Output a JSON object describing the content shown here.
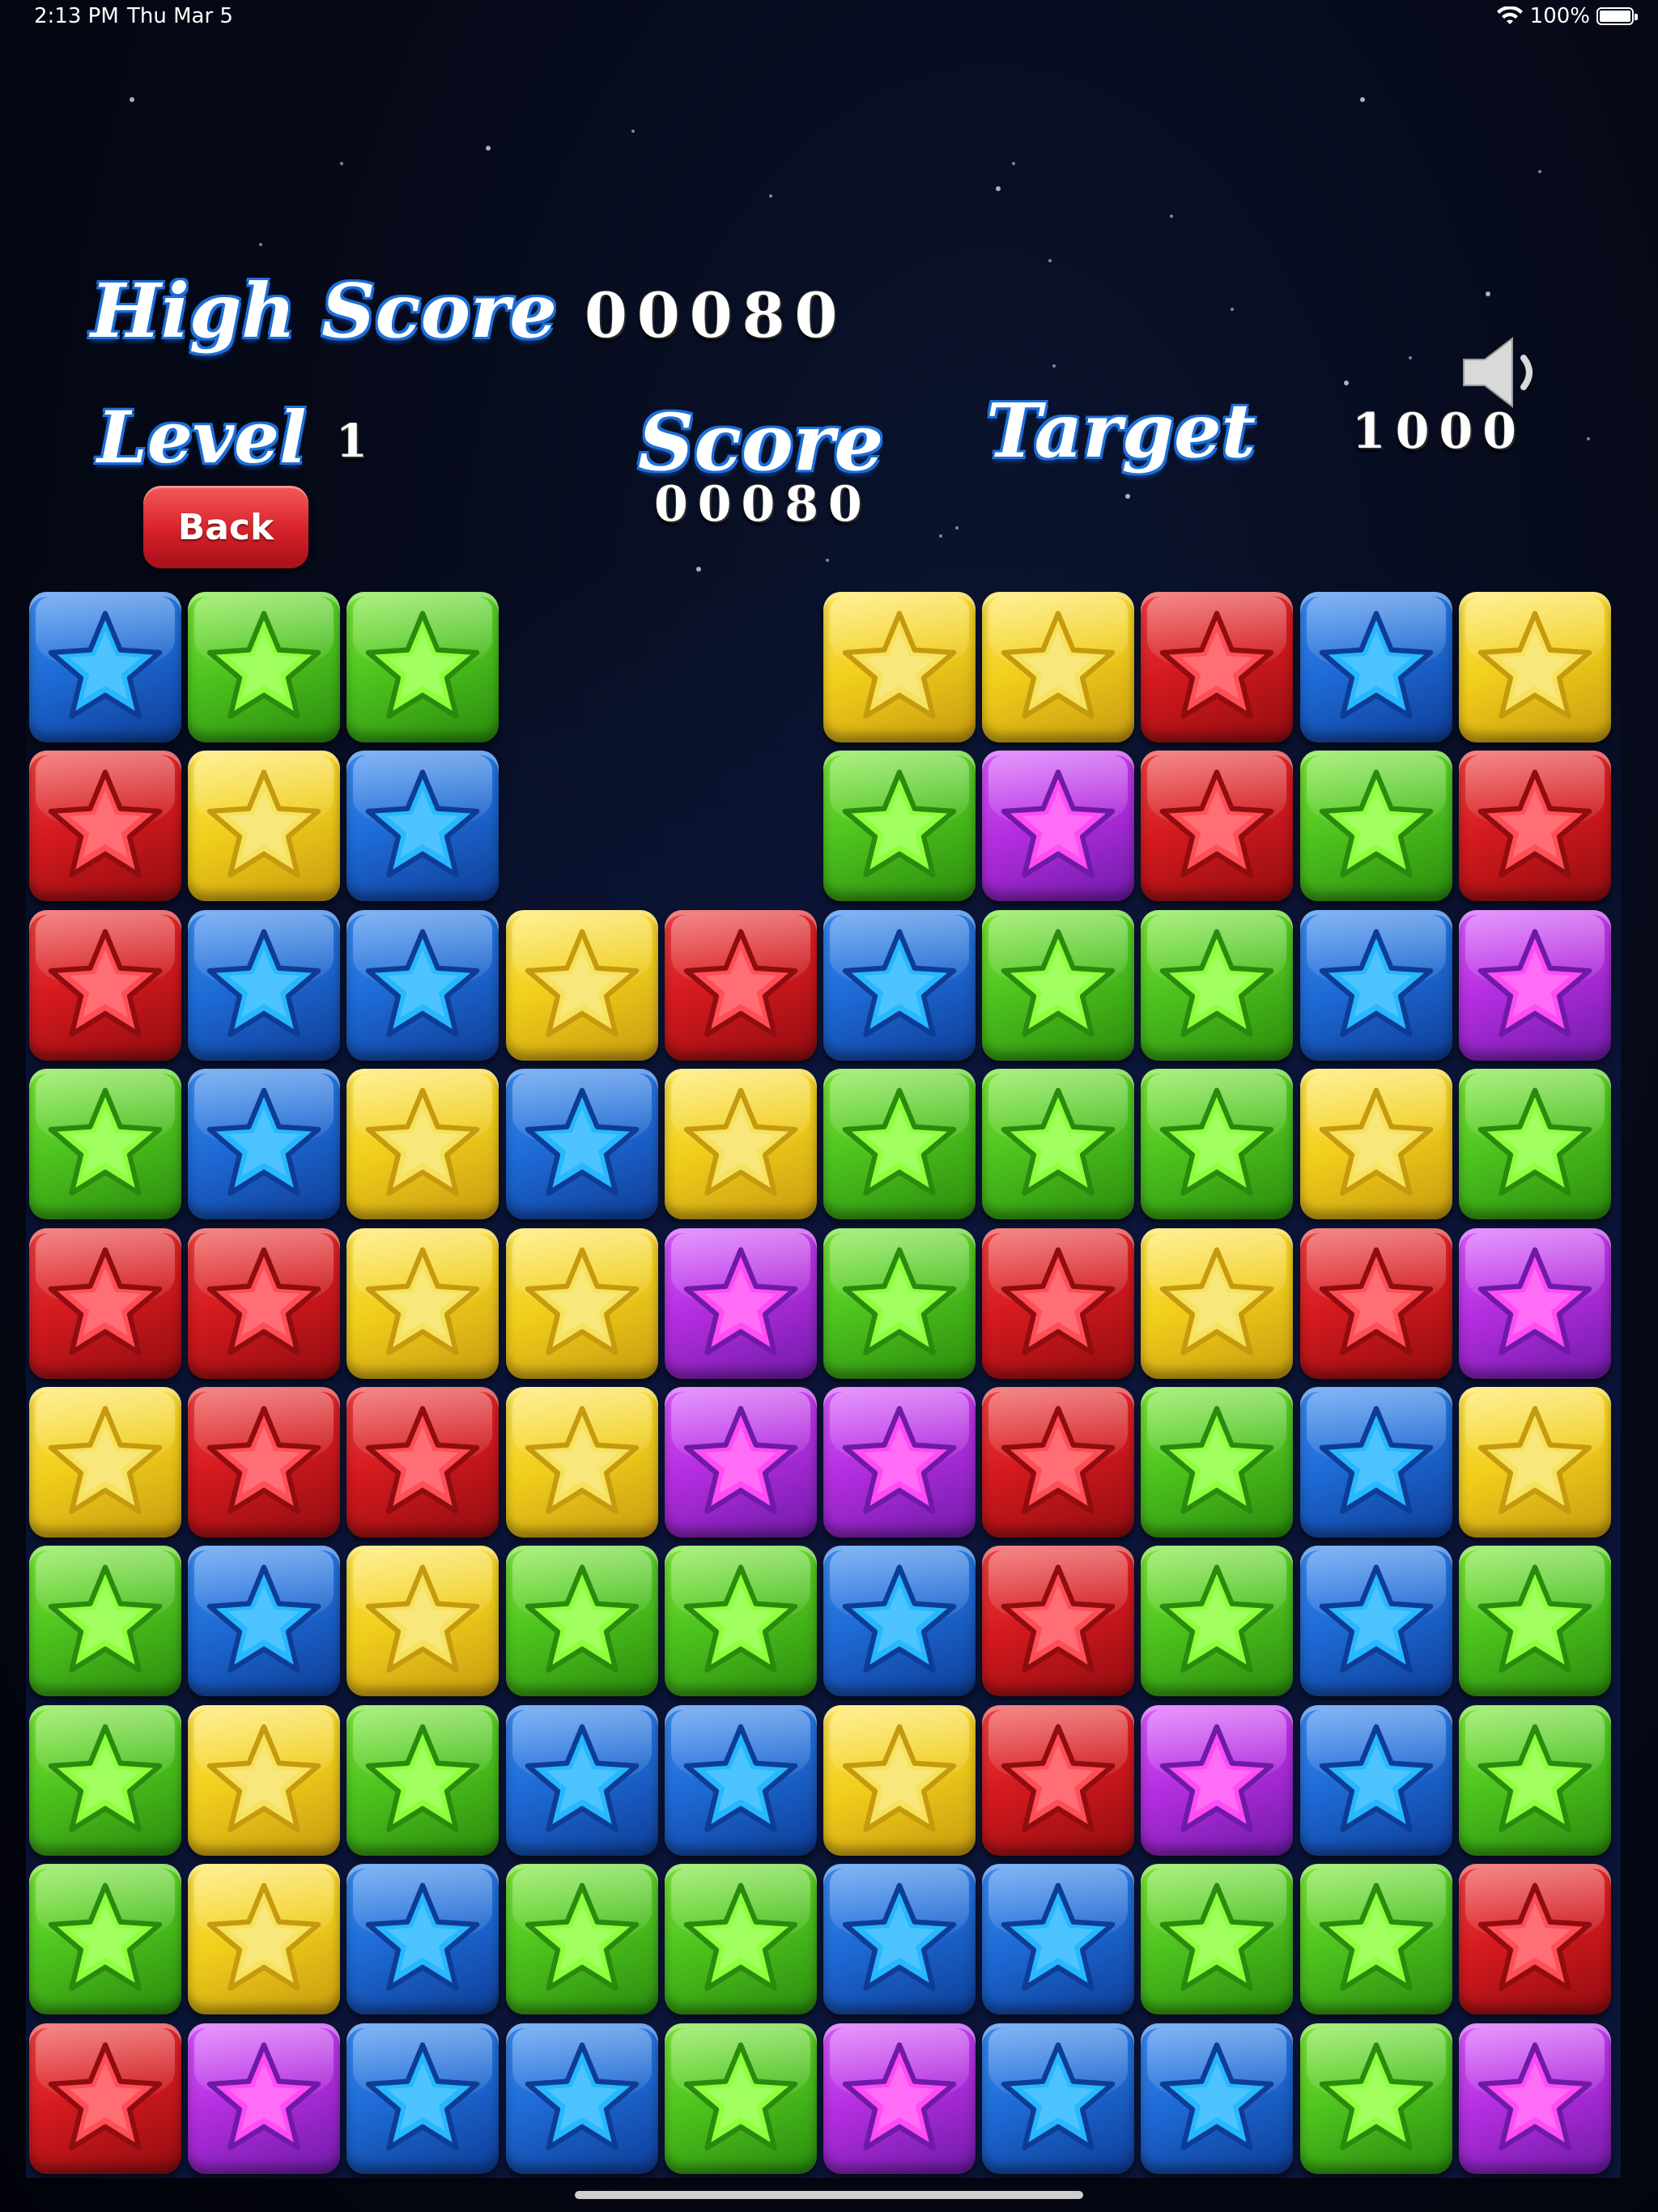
{
  "status_bar": {
    "time": "2:13 PM",
    "date": "Thu Mar 5",
    "battery": "100%",
    "wifi_icon": "wifi-icon",
    "battery_icon": "battery-icon"
  },
  "hud": {
    "high_score_label": "High Score",
    "high_score_value": "00080",
    "level_label": "Level",
    "level_value": "1",
    "score_label": "Score",
    "score_value": "00080",
    "target_label": "Target",
    "target_value": "1000",
    "back_label": "Back",
    "sound_icon": "speaker-icon"
  },
  "colors": {
    "blue": "#1e6bd6",
    "green": "#4ec41f",
    "yellow": "#f2cf1c",
    "red": "#d51a1e",
    "purple": "#b52ee0"
  },
  "board": {
    "rows": 10,
    "cols": 10,
    "grid": [
      [
        "B",
        "G",
        "G",
        "",
        "",
        "Y",
        "Y",
        "R",
        "B",
        "Y"
      ],
      [
        "R",
        "Y",
        "B",
        "",
        "",
        "G",
        "P",
        "R",
        "G",
        "R"
      ],
      [
        "R",
        "B",
        "B",
        "Y",
        "R",
        "B",
        "G",
        "G",
        "B",
        "P"
      ],
      [
        "G",
        "B",
        "Y",
        "B",
        "Y",
        "G",
        "G",
        "G",
        "Y",
        "G"
      ],
      [
        "R",
        "R",
        "Y",
        "Y",
        "P",
        "G",
        "R",
        "Y",
        "R",
        "P"
      ],
      [
        "Y",
        "R",
        "R",
        "Y",
        "P",
        "P",
        "R",
        "G",
        "B",
        "Y"
      ],
      [
        "G",
        "B",
        "Y",
        "G",
        "G",
        "B",
        "R",
        "G",
        "B",
        "G"
      ],
      [
        "G",
        "Y",
        "G",
        "B",
        "B",
        "Y",
        "R",
        "P",
        "B",
        "G"
      ],
      [
        "G",
        "Y",
        "B",
        "G",
        "G",
        "B",
        "B",
        "G",
        "G",
        "R"
      ],
      [
        "R",
        "P",
        "B",
        "B",
        "G",
        "P",
        "B",
        "B",
        "G",
        "P"
      ]
    ]
  }
}
